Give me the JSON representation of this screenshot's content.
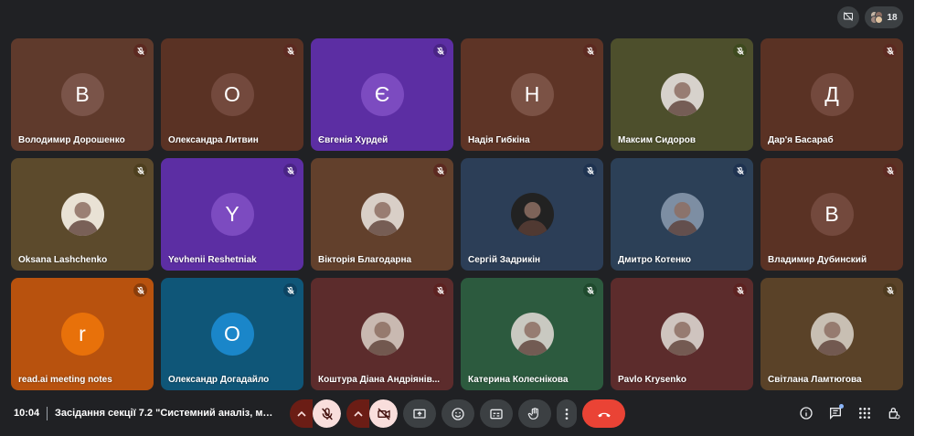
{
  "topbar": {
    "participant_count": "18"
  },
  "participants": [
    {
      "name": "Володимир Дорошенко",
      "initial": "В",
      "tile_color": "#5f3a2c",
      "avatar_color": "#7a5449",
      "mic_color": "#5c2a21",
      "photo": false
    },
    {
      "name": "Олександра Литвин",
      "initial": "О",
      "tile_color": "#5a3224",
      "avatar_color": "#73493d",
      "mic_color": "#5c2a21",
      "photo": false
    },
    {
      "name": "Євгенія Хурдей",
      "initial": "Є",
      "tile_color": "#5c2ea3",
      "avatar_color": "#7c4bc0",
      "mic_color": "#4a2486",
      "photo": false
    },
    {
      "name": "Надія Гибкіна",
      "initial": "Н",
      "tile_color": "#5e3426",
      "avatar_color": "#7b5245",
      "mic_color": "#5c2a21",
      "photo": false
    },
    {
      "name": "Максим Сидоров",
      "initial": "",
      "tile_color": "#4d4f2c",
      "avatar_color": "#d7d2cc",
      "mic_color": "#3e4a1f",
      "photo": true
    },
    {
      "name": "Дар'я Басараб",
      "initial": "Д",
      "tile_color": "#5a3224",
      "avatar_color": "#73493d",
      "mic_color": "#5c2a21",
      "photo": false
    },
    {
      "name": "Oksana Lashchenko",
      "initial": "",
      "tile_color": "#5c4a2c",
      "avatar_color": "#e9e2d5",
      "mic_color": "#4e3f1f",
      "photo": true
    },
    {
      "name": "Yevhenii Reshetniak",
      "initial": "Y",
      "tile_color": "#5c2ea3",
      "avatar_color": "#7c4bc0",
      "mic_color": "#4a2486",
      "photo": false
    },
    {
      "name": "Вікторія Благодарна",
      "initial": "",
      "tile_color": "#62402c",
      "avatar_color": "#d9cfc7",
      "mic_color": "#5c2a21",
      "photo": true
    },
    {
      "name": "Сергій Задрикін",
      "initial": "",
      "tile_color": "#2c3e57",
      "avatar_color": "#222222",
      "mic_color": "#1f3350",
      "photo": true
    },
    {
      "name": "Дмитро Котенко",
      "initial": "",
      "tile_color": "#2c4057",
      "avatar_color": "#7d8ea3",
      "mic_color": "#1f3350",
      "photo": true
    },
    {
      "name": "Владимир Дубинский",
      "initial": "В",
      "tile_color": "#5a3224",
      "avatar_color": "#73493d",
      "mic_color": "#5c2a21",
      "photo": false
    },
    {
      "name": "read.ai meeting notes",
      "initial": "r",
      "tile_color": "#b8520e",
      "avatar_color": "#e8710a",
      "mic_color": "#8a3d0a",
      "photo": false
    },
    {
      "name": "Олександр Догадайло",
      "initial": "О",
      "tile_color": "#0f5678",
      "avatar_color": "#1a86c9",
      "mic_color": "#0c4463",
      "photo": false
    },
    {
      "name": "Коштура Діана Андріянів...",
      "initial": "",
      "tile_color": "#5c2c2c",
      "avatar_color": "#c9b9b1",
      "mic_color": "#5c2221",
      "photo": true
    },
    {
      "name": "Катерина Колеснікова",
      "initial": "",
      "tile_color": "#2c5a3e",
      "avatar_color": "#c9c9c1",
      "mic_color": "#1f4a2e",
      "photo": true
    },
    {
      "name": "Pavlo Krysenko",
      "initial": "",
      "tile_color": "#5c2c2c",
      "avatar_color": "#cfc4bf",
      "mic_color": "#5c2221",
      "photo": true
    },
    {
      "name": "Світлана Ламтюгова",
      "initial": "",
      "tile_color": "#5a4228",
      "avatar_color": "#c8bfb3",
      "mic_color": "#4e3a1f",
      "photo": true
    }
  ],
  "bottombar": {
    "time": "10:04",
    "meeting_title": "Засідання секції 7.2 \"Системний аналіз, матем..."
  },
  "icons": {
    "mic": "mic-off-icon",
    "camera": "camera-off-icon",
    "present": "present-screen-icon",
    "emoji": "emoji-icon",
    "captions": "captions-icon",
    "hand": "raise-hand-icon",
    "more": "more-vert-icon",
    "end": "end-call-icon",
    "info": "info-icon",
    "chat": "chat-icon",
    "activities": "apps-grid-icon",
    "host": "host-controls-icon"
  },
  "colors": {
    "background": "#202124",
    "end_call": "#ea4335",
    "muted_control": "#f9dedc"
  }
}
